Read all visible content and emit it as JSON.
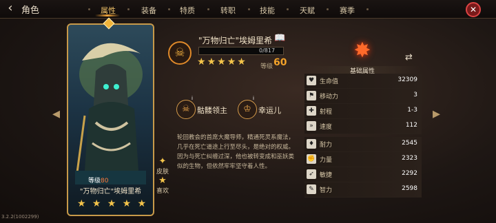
{
  "header": {
    "title": "角色",
    "tabs": [
      {
        "label": "属性",
        "active": true
      },
      {
        "label": "装备"
      },
      {
        "label": "特质"
      },
      {
        "label": "转职"
      },
      {
        "label": "技能"
      },
      {
        "label": "天赋"
      },
      {
        "label": "赛季"
      }
    ]
  },
  "card": {
    "level_prefix": "等级",
    "level_value": "80",
    "name": "\"万物归亡\"埃姆里希",
    "stars": 5
  },
  "side_buttons": {
    "skin": "皮肤",
    "like": "喜欢"
  },
  "hero": {
    "name": "\"万物归亡\"埃姆里希",
    "xp_text": "0/817",
    "xp_fraction": 0,
    "stars": 5,
    "level_label": "等级",
    "level_value": "60"
  },
  "skills": [
    {
      "label": "骷髅领主",
      "icon": "skull-icon"
    },
    {
      "label": "幸运儿",
      "icon": "crown-icon"
    }
  ],
  "lore": "轮回教会的首席大魔导师，精通死灵系魔法，几乎在死亡道途上行至尽头，是绝对的权威。因为与死亡纠缠过深，他也被转变成和巫妖类似的生物，但依然牢牢坚守着人性。",
  "stats": {
    "title": "基础属性",
    "rows": [
      {
        "icon": "heart-icon",
        "name": "生命值",
        "value": "32309"
      },
      {
        "icon": "boot-icon",
        "name": "移动力",
        "value": "3"
      },
      {
        "icon": "range-icon",
        "name": "射程",
        "value": "1-3"
      },
      {
        "icon": "speed-icon",
        "name": "速度",
        "value": "112"
      },
      {
        "icon": "endurance-icon",
        "name": "耐力",
        "value": "2545"
      },
      {
        "icon": "strength-icon",
        "name": "力量",
        "value": "2323"
      },
      {
        "icon": "agility-icon",
        "name": "敏捷",
        "value": "2292"
      },
      {
        "icon": "intellect-icon",
        "name": "智力",
        "value": "2598"
      }
    ]
  },
  "version": "3.2.2(1002299)"
}
